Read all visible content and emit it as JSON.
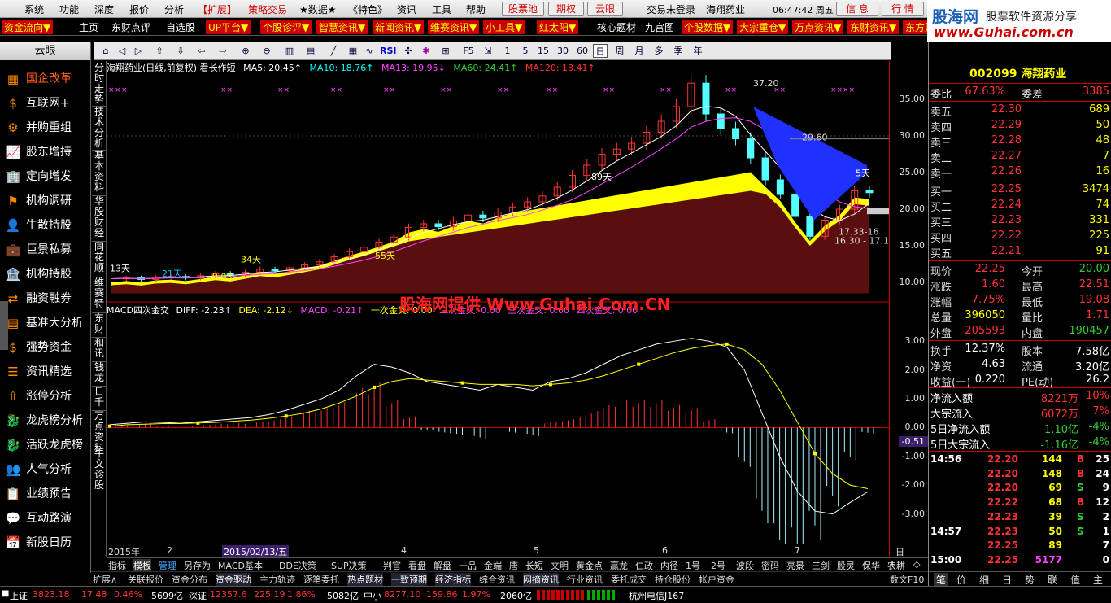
{
  "menu": {
    "items": [
      "系统",
      "功能",
      "深度",
      "报价",
      "分析",
      "【扩展】",
      "策略交易",
      "★数据★",
      "《特色》",
      "资讯",
      "工具",
      "帮助"
    ],
    "right_btn1": "股票池",
    "right_btn2": "期权",
    "right_btn3": "云眼",
    "login": "交易未登录",
    "stock_name": "海翔药业",
    "clock": "06:47:42 周五",
    "info_btn": "信 息",
    "quote_btn": "行 情"
  },
  "toolbar2": {
    "items": [
      "资金流向▼",
      "主页",
      "东财点评",
      "自选股",
      "UP平台▼",
      "个股诊评▼",
      "智慧资讯▼",
      "新闻资讯▼",
      "维赛资讯▼",
      "小工具▼",
      "红太阳▼",
      "核心题材",
      "九宫图",
      "个股数据▼",
      "大宗重仓▼",
      "万点资讯▼",
      "东财资讯▼",
      "东方财"
    ]
  },
  "logo": {
    "title": "股海网",
    "subtitle": "股票软件资源分享",
    "url": "www.Guhai.com.cn"
  },
  "toolbar3": {
    "periods": [
      "1",
      "5",
      "15",
      "30",
      "60",
      "日",
      "周",
      "月",
      "多",
      "季",
      "年"
    ],
    "selected": "日",
    "rsi": "RSI"
  },
  "leftpanel": {
    "title": "云眼",
    "items": [
      "国企改革",
      "互联网+",
      "并购重组",
      "股东增持",
      "定向增发",
      "机构调研",
      "牛散持股",
      "巨景私募",
      "机构持股",
      "融资融券",
      "基准大分析",
      "强势资金",
      "资讯精选",
      "涨停分析",
      "龙虎榜分析",
      "活跃龙虎榜",
      "人气分析",
      "业绩预告",
      "互动路演",
      "新股日历"
    ]
  },
  "vtabs": [
    "分时走势",
    "技术分析",
    "基本资料",
    "华股财经",
    "同花顺",
    "维赛特",
    "东财",
    "和讯",
    "钱龙",
    "日千",
    "万点资料",
    "牛文诊股"
  ],
  "price_header": {
    "title": "海翔药业(日线,前复权) 看长作短",
    "ma5": "MA5: 20.45↑",
    "ma10": "MA10: 18.76↑",
    "ma13": "MA13: 19.95↓",
    "ma60": "MA60: 24.41↑",
    "ma120": "MA120: 18.41↑"
  },
  "macd_header": {
    "title": "MACD四次金交",
    "diff": "DIFF: -2.23↑",
    "dea": "DEA: -2.12↓",
    "macd": "MACD: -0.21↑",
    "j1": "一次金叉: 0.00",
    "j2": "二次金叉: 0.00",
    "j3": "三次金叉: 0.00",
    "j4": "四次金叉: 0.00"
  },
  "watermark": "股海网提供 Www.Guhai.Com.CN",
  "chart_annotations": {
    "peak": "37.20",
    "level": "29.60",
    "range": "16.30 - 17.1",
    "d5": "5天",
    "d13": "13天",
    "d21": "21天",
    "d34": "34天",
    "d55": "55天",
    "d89": "89天",
    "low": "9.03",
    "c2": "17.33-16"
  },
  "chart_data": [
    {
      "type": "line",
      "title": "海翔药业(日线,前复权) 看长作短",
      "y_ticks": [
        "35.00",
        "30.00",
        "25.00",
        "20.00",
        "15.00",
        "10.00"
      ],
      "ylim": [
        8,
        38
      ],
      "x_ticks": [
        "2015年",
        "2",
        "2015/02/13/五",
        "4",
        "5",
        "6",
        "7"
      ],
      "series": [
        {
          "name": "price",
          "values": [
            10.5,
            10.6,
            10.4,
            10.7,
            10.8,
            10.6,
            10.9,
            11.2,
            11.0,
            11.4,
            11.8,
            11.6,
            12.0,
            12.4,
            12.8,
            13.5,
            14.2,
            14.8,
            15.5,
            16.2,
            17.5,
            18.0,
            17.6,
            18.4,
            19.2,
            18.8,
            19.6,
            20.3,
            21.0,
            21.8,
            23.0,
            24.6,
            26.0,
            27.5,
            28.2,
            29.0,
            30.5,
            32.0,
            34.0,
            37.2,
            33.0,
            31.0,
            29.6,
            27.0,
            24.0,
            22.0,
            19.0,
            16.3,
            18.5,
            20.0,
            22.5,
            22.25
          ]
        }
      ]
    },
    {
      "type": "line",
      "title": "MACD四次金交",
      "y_ticks": [
        "3.00",
        "2.00",
        "1.00",
        "0.00",
        "-1.00",
        "-2.00",
        "-3.00"
      ],
      "ylim": [
        -4,
        3.8
      ],
      "series": [
        {
          "name": "DIFF",
          "values": [
            0.1,
            0.15,
            0.2,
            0.18,
            0.15,
            0.2,
            0.25,
            0.3,
            0.35,
            0.45,
            0.6,
            0.8,
            1.0,
            1.3,
            1.8,
            2.2,
            2.1,
            1.9,
            1.6,
            1.5,
            1.4,
            1.3,
            1.5,
            1.4,
            1.3,
            1.6,
            1.7,
            1.9,
            2.2,
            2.5,
            2.7,
            2.9,
            3.0,
            3.1,
            3.0,
            2.8,
            2.0,
            0.5,
            -1.0,
            -2.2,
            -2.9,
            -3.0,
            -2.6,
            -2.23
          ]
        },
        {
          "name": "DEA",
          "values": [
            0.05,
            0.1,
            0.12,
            0.14,
            0.14,
            0.16,
            0.18,
            0.22,
            0.26,
            0.32,
            0.4,
            0.5,
            0.65,
            0.85,
            1.1,
            1.4,
            1.6,
            1.7,
            1.65,
            1.6,
            1.55,
            1.5,
            1.5,
            1.5,
            1.45,
            1.5,
            1.55,
            1.65,
            1.8,
            2.0,
            2.2,
            2.4,
            2.6,
            2.75,
            2.85,
            2.9,
            2.7,
            2.2,
            1.3,
            0.2,
            -0.9,
            -1.6,
            -2.0,
            -2.12
          ]
        },
        {
          "name": "MACD",
          "values": [
            0.1,
            0.1,
            0.16,
            0.08,
            0.02,
            0.08,
            0.14,
            0.16,
            0.18,
            0.26,
            0.4,
            0.6,
            0.7,
            0.9,
            1.4,
            1.6,
            1.0,
            0.4,
            -0.1,
            -0.2,
            -0.3,
            -0.4,
            0.0,
            -0.2,
            -0.3,
            0.2,
            0.3,
            0.5,
            0.8,
            1.0,
            1.0,
            1.0,
            0.8,
            0.7,
            0.3,
            -0.2,
            -1.4,
            -3.4,
            -4.6,
            -4.8,
            -4.0,
            -2.8,
            -1.2,
            -0.21
          ]
        }
      ]
    }
  ],
  "xaxis": {
    "labels": [
      "2015年",
      "2",
      "2015/02/13/五",
      "4",
      "5",
      "6",
      "7"
    ],
    "right": "日线"
  },
  "tabbar1": [
    "指标",
    "模板",
    "管理",
    "另存为",
    "MACD基本",
    "DDE决策",
    "SUP决策",
    "判官",
    "看盘",
    "解盘",
    "一品",
    "金端",
    "唐",
    "长短",
    "文明",
    "黄金点",
    "赢龙",
    "仁政",
    "内径",
    "1号",
    "2号",
    "波段",
    "密码",
    "亮景",
    "三剑",
    "股灵",
    "保华",
    "农耕"
  ],
  "tabbar1_selected": "模板",
  "tabbar2": [
    "扩展∧",
    "关联报价",
    "资金分布",
    "资金驱动",
    "主力轨迹",
    "逐笔委托",
    "热点题材",
    "一致预期",
    "经济指标",
    "综合资讯",
    "网摘资讯",
    "行业资讯",
    "委托成交",
    "持仓股份",
    "帐户资金"
  ],
  "rightpanel": {
    "code": "002099",
    "name": "海翔药业",
    "weibi_label": "委比",
    "weibi": "67.63%",
    "weicha_label": "委差",
    "weicha": "3385",
    "asks": [
      {
        "label": "卖五",
        "price": "22.30",
        "vol": "689"
      },
      {
        "label": "卖四",
        "price": "22.29",
        "vol": "50"
      },
      {
        "label": "卖三",
        "price": "22.28",
        "vol": "48"
      },
      {
        "label": "卖二",
        "price": "22.27",
        "vol": "7"
      },
      {
        "label": "卖一",
        "price": "22.26",
        "vol": "16"
      }
    ],
    "bids": [
      {
        "label": "买一",
        "price": "22.25",
        "vol": "3474"
      },
      {
        "label": "买二",
        "price": "22.24",
        "vol": "74"
      },
      {
        "label": "买三",
        "price": "22.23",
        "vol": "331"
      },
      {
        "label": "买四",
        "price": "22.22",
        "vol": "225"
      },
      {
        "label": "买五",
        "price": "22.21",
        "vol": "91"
      }
    ],
    "stats": [
      {
        "l1": "现价",
        "v1": "22.25",
        "l2": "今开",
        "v2": "20.00"
      },
      {
        "l1": "涨跌",
        "v1": "1.60",
        "l2": "最高",
        "v2": "22.51"
      },
      {
        "l1": "涨幅",
        "v1": "7.75%",
        "l2": "最低",
        "v2": "19.08"
      },
      {
        "l1": "总量",
        "v1": "396050",
        "l2": "量比",
        "v2": "1.71"
      },
      {
        "l1": "外盘",
        "v1": "205593",
        "l2": "内盘",
        "v2": "190457"
      }
    ],
    "fund": [
      {
        "l1": "换手",
        "v1": "12.37%",
        "l2": "股本",
        "v2": "7.58亿"
      },
      {
        "l1": "净资",
        "v1": "4.63",
        "l2": "流通",
        "v2": "3.20亿"
      },
      {
        "l1": "收益(一)",
        "v1": "0.220",
        "l2": "PE(动)",
        "v2": "26.2"
      }
    ],
    "flows": [
      {
        "l": "净流入额",
        "v": "8221万",
        "p": "10%"
      },
      {
        "l": "大宗流入",
        "v": "6072万",
        "p": "7%"
      },
      {
        "l": "5日净流入额",
        "v": "-1.10亿",
        "p": "-4%"
      },
      {
        "l": "5日大宗流入",
        "v": "-1.16亿",
        "p": "-4%"
      }
    ],
    "ticks": [
      {
        "t": "14:56",
        "p": "22.20",
        "v": "144",
        "d": "B",
        "n": "25"
      },
      {
        "t": "",
        "p": "22.20",
        "v": "148",
        "d": "B",
        "n": "24"
      },
      {
        "t": "",
        "p": "22.20",
        "v": "69",
        "d": "S",
        "n": "9"
      },
      {
        "t": "",
        "p": "22.22",
        "v": "68",
        "d": "B",
        "n": "12"
      },
      {
        "t": "",
        "p": "22.23",
        "v": "39",
        "d": "S",
        "n": "2"
      },
      {
        "t": "14:57",
        "p": "22.23",
        "v": "50",
        "d": "S",
        "n": "1"
      },
      {
        "t": "",
        "p": "22.25",
        "v": "89",
        "d": "",
        "n": "7"
      },
      {
        "t": "15:00",
        "p": "22.25",
        "v": "5177",
        "d": "",
        "n": "0"
      }
    ],
    "tabs": [
      "笔",
      "价",
      "细",
      "日",
      "势",
      "联",
      "值",
      "主"
    ]
  },
  "statusbar": {
    "sh_label": "上证",
    "sh_val": "3823.18",
    "sh_chg": "17.48",
    "sh_pct": "0.46%",
    "sh_amt": "5699亿",
    "sz_label": "深证",
    "sz_val": "12357.6",
    "sz_chg": "225.19",
    "sz_pct": "1.86%",
    "sz_amt": "5082亿",
    "zx_label": "中小",
    "zx_val": "8277.10",
    "zx_chg": "159.86",
    "zx_pct": "1.97%",
    "zx_amt": "2060亿",
    "server": "杭州电信J167"
  },
  "colors": {
    "up": "#ff3333",
    "down": "#33cc33",
    "accent": "#ffff00"
  }
}
